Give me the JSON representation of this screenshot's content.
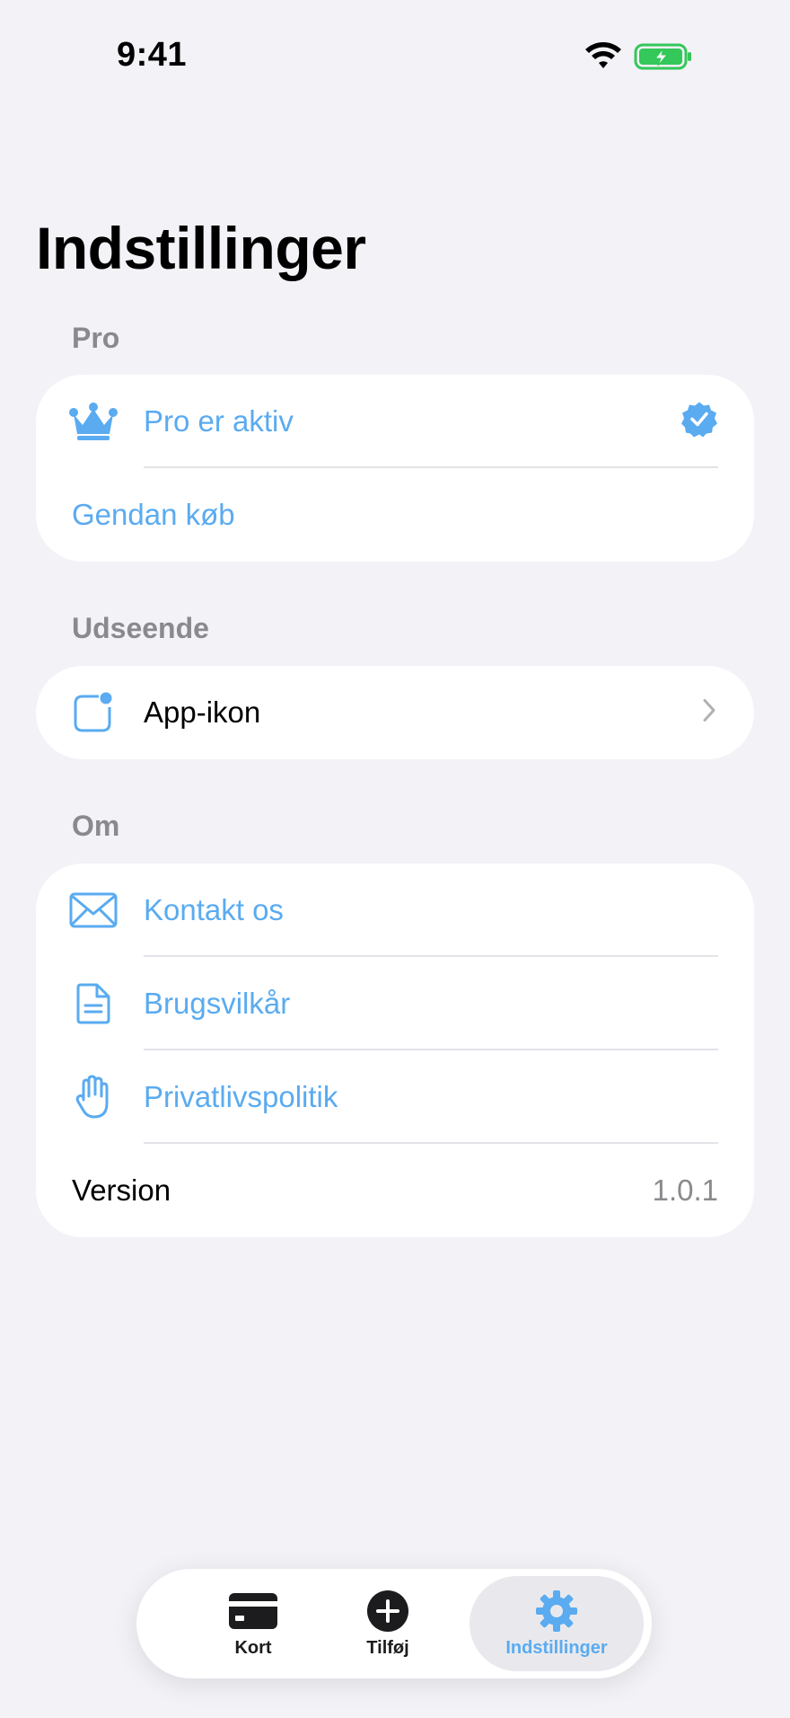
{
  "status_bar": {
    "time": "9:41",
    "wifi_icon": "wifi-icon",
    "battery_icon": "battery-charging-icon"
  },
  "page": {
    "title": "Indstillinger"
  },
  "sections": {
    "pro": {
      "header": "Pro",
      "rows": {
        "pro_active": {
          "label": "Pro er aktiv",
          "icon": "crown-icon",
          "trailing_icon": "verified-badge-icon"
        },
        "restore": {
          "label": "Gendan køb"
        }
      }
    },
    "appearance": {
      "header": "Udseende",
      "rows": {
        "app_icon": {
          "label": "App-ikon",
          "icon": "app-badge-icon",
          "trailing_icon": "chevron-right-icon"
        }
      }
    },
    "about": {
      "header": "Om",
      "rows": {
        "contact": {
          "label": "Kontakt os",
          "icon": "envelope-icon"
        },
        "terms": {
          "label": "Brugsvilkår",
          "icon": "document-icon"
        },
        "privacy": {
          "label": "Privatlivspolitik",
          "icon": "hand-raised-icon"
        },
        "version": {
          "label": "Version",
          "value": "1.0.1"
        }
      }
    }
  },
  "tab_bar": {
    "tabs": [
      {
        "label": "Kort",
        "icon": "credit-card-icon",
        "selected": false
      },
      {
        "label": "Tilføj",
        "icon": "plus-circle-icon",
        "selected": false
      },
      {
        "label": "Indstillinger",
        "icon": "gear-icon",
        "selected": true
      }
    ]
  },
  "colors": {
    "background": "#f2f2f7",
    "accent": "#5aabf0",
    "secondary_text": "#8a8a8e",
    "card": "#ffffff"
  }
}
